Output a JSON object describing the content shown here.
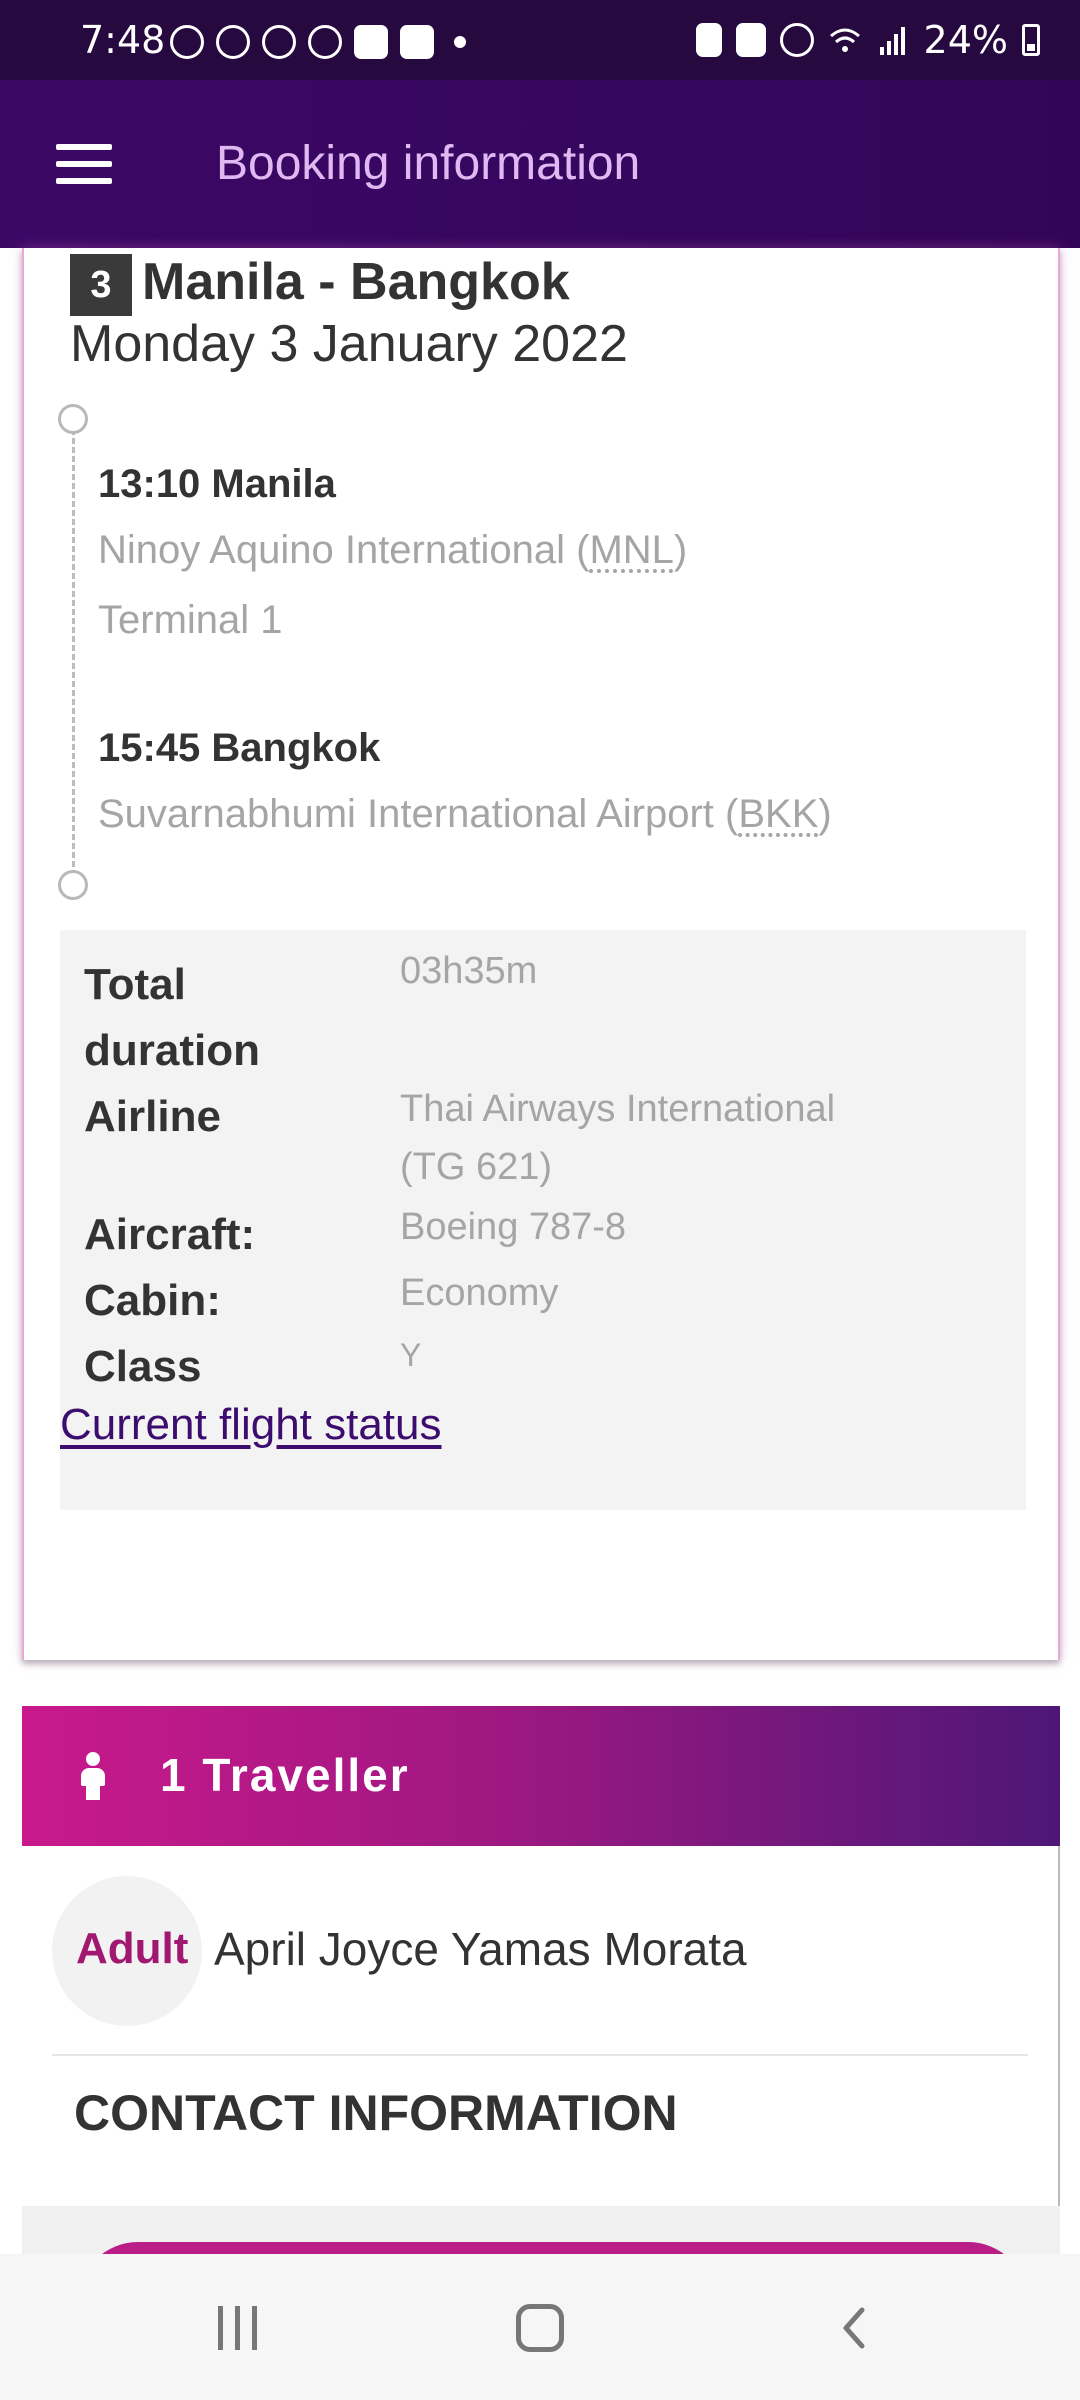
{
  "status_bar": {
    "time": "7:48",
    "battery": "24%"
  },
  "app_bar": {
    "title": "Booking information"
  },
  "segment": {
    "number": "3",
    "route": "Manila - Bangkok",
    "date": "Monday 3 January 2022",
    "departure": {
      "time_city": "13:10 Manila",
      "airport_name": "Ninoy Aquino International (",
      "airport_code": "MNL",
      "airport_close": ")",
      "terminal": "Terminal 1"
    },
    "arrival": {
      "time_city": "15:45 Bangkok",
      "airport_name": "Suvarnabhumi International Airport (",
      "airport_code": "BKK",
      "airport_close": ")"
    },
    "details": {
      "total_duration_label_1": "Total",
      "total_duration_label_2": "duration",
      "total_duration": "03h35m",
      "airline_label": "Airline",
      "airline_1": "Thai Airways International",
      "airline_2": "(TG 621)",
      "aircraft_label": "Aircraft:",
      "aircraft": "Boeing 787-8",
      "cabin_label": "Cabin:",
      "cabin": "Economy",
      "class_label": "Class",
      "class": "Y"
    },
    "status_link": "Current flight status"
  },
  "travellers": {
    "header": "1 Traveller",
    "list": [
      {
        "type": "Adult",
        "name": "April Joyce Yamas Morata"
      }
    ],
    "contact_title": "CONTACT INFORMATION"
  },
  "colors": {
    "status_bar": "#26093f",
    "app_bar": "#3c0866",
    "app_title": "#e0b8f2",
    "accent_magenta": "#c9198c",
    "link": "#3c0c6e"
  }
}
